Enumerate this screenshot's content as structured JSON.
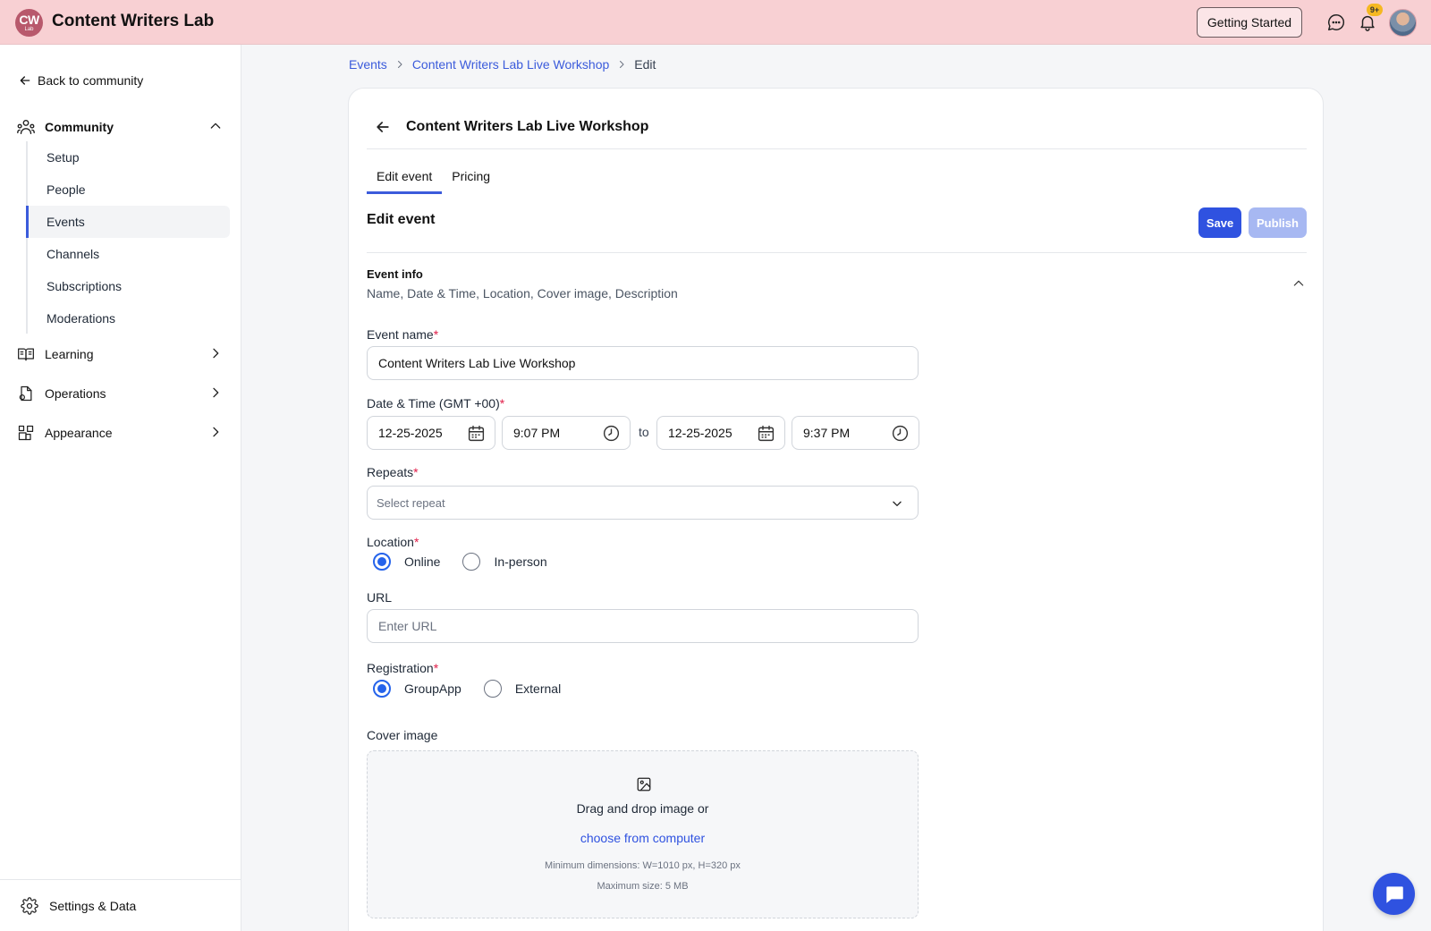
{
  "app": {
    "logo_line1": "CW",
    "logo_line2": "Lab",
    "name": "Content Writers Lab",
    "getting_started": "Getting Started",
    "notification_count": "9+"
  },
  "sidebar": {
    "back_label": "Back to community",
    "community_label": "Community",
    "community_items": [
      {
        "label": "Setup"
      },
      {
        "label": "People"
      },
      {
        "label": "Events",
        "active": true
      },
      {
        "label": "Channels"
      },
      {
        "label": "Subscriptions"
      },
      {
        "label": "Moderations"
      }
    ],
    "groups": [
      {
        "label": "Learning",
        "icon": "book-icon"
      },
      {
        "label": "Operations",
        "icon": "document-icon"
      },
      {
        "label": "Appearance",
        "icon": "grid-icon"
      }
    ],
    "settings_label": "Settings & Data"
  },
  "breadcrumb": {
    "items": [
      "Events",
      "Content Writers Lab Live Workshop",
      "Edit"
    ]
  },
  "card": {
    "title": "Content Writers Lab Live Workshop",
    "tabs": [
      "Edit event",
      "Pricing"
    ],
    "active_tab": "Edit event",
    "section_title": "Edit event",
    "save_label": "Save",
    "publish_label": "Publish"
  },
  "event_info": {
    "title": "Event info",
    "subtitle": "Name, Date & Time, Location, Cover image, Description"
  },
  "form": {
    "event_name_label": "Event name",
    "event_name_value": "Content Writers Lab Live Workshop",
    "datetime_label": "Date & Time (GMT +00)",
    "start_date": "12-25-2025",
    "start_time": "9:07 PM",
    "to_label": "to",
    "end_date": "12-25-2025",
    "end_time": "9:37 PM",
    "repeats_label": "Repeats",
    "repeats_placeholder": "Select repeat",
    "location_label": "Location",
    "location_options": [
      "Online",
      "In-person"
    ],
    "location_selected": "Online",
    "url_label": "URL",
    "url_placeholder": "Enter URL",
    "registration_label": "Registration",
    "registration_options": [
      "GroupApp",
      "External"
    ],
    "registration_selected": "GroupApp",
    "required_mark": "*"
  },
  "cover_image": {
    "label": "Cover image",
    "drag_text": "Drag and drop image or",
    "choose_link": "choose from computer",
    "min_dimensions": "Minimum dimensions: W=1010 px, H=320 px",
    "max_size": "Maximum size: 5 MB"
  },
  "colors": {
    "topbar_bg": "#f8d0d3",
    "accent": "#2f52e0",
    "publish_disabled": "#a7b8f2",
    "required": "#e11d48"
  }
}
